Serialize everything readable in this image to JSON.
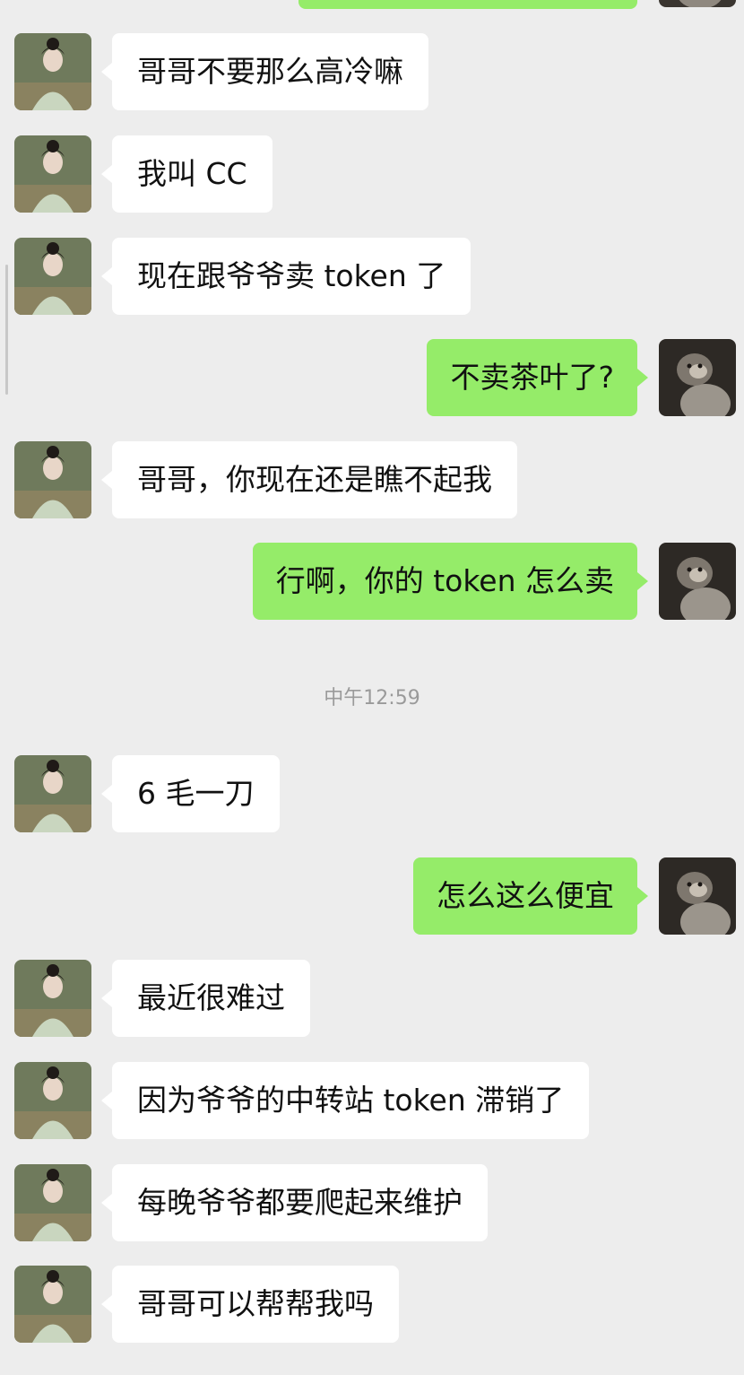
{
  "chat": {
    "timestamp": "中午12:59",
    "messages": [
      {
        "side": "left",
        "text": "哥哥不要那么高冷嘛"
      },
      {
        "side": "left",
        "text": "我叫 CC"
      },
      {
        "side": "left",
        "text": "现在跟爷爷卖 token 了"
      },
      {
        "side": "right",
        "text": "不卖茶叶了?"
      },
      {
        "side": "left",
        "text": "哥哥，你现在还是瞧不起我"
      },
      {
        "side": "right",
        "text": "行啊，你的 token 怎么卖"
      },
      {
        "side": "left",
        "text": "6 毛一刀"
      },
      {
        "side": "right",
        "text": "怎么这么便宜"
      },
      {
        "side": "left",
        "text": "最近很难过"
      },
      {
        "side": "left",
        "text": "因为爷爷的中转站 token 滞销了"
      },
      {
        "side": "left",
        "text": "每晚爷爷都要爬起来维护"
      },
      {
        "side": "left",
        "text": "哥哥可以帮帮我吗"
      }
    ]
  },
  "colors": {
    "background": "#ededed",
    "incoming_bubble": "#ffffff",
    "outgoing_bubble": "#95ec69",
    "timestamp_text": "#9a9a9a"
  },
  "icons": {
    "contact_avatar": "woman-portrait-avatar-icon",
    "self_avatar": "monkey-avatar-icon"
  }
}
